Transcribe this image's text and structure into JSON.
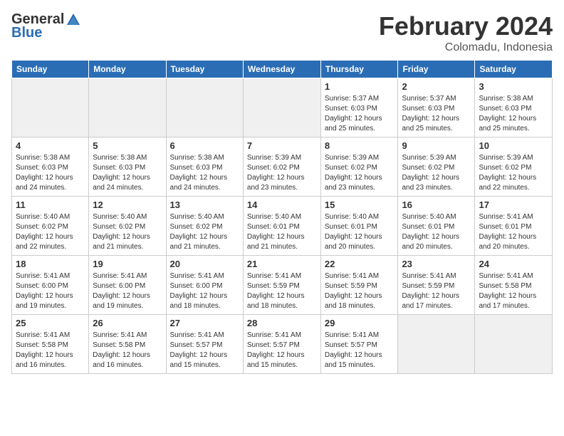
{
  "header": {
    "logo_general": "General",
    "logo_blue": "Blue",
    "month": "February 2024",
    "location": "Colomadu, Indonesia"
  },
  "weekdays": [
    "Sunday",
    "Monday",
    "Tuesday",
    "Wednesday",
    "Thursday",
    "Friday",
    "Saturday"
  ],
  "weeks": [
    [
      {
        "day": "",
        "info": "",
        "empty": true
      },
      {
        "day": "",
        "info": "",
        "empty": true
      },
      {
        "day": "",
        "info": "",
        "empty": true
      },
      {
        "day": "",
        "info": "",
        "empty": true
      },
      {
        "day": "1",
        "info": "Sunrise: 5:37 AM\nSunset: 6:03 PM\nDaylight: 12 hours\nand 25 minutes."
      },
      {
        "day": "2",
        "info": "Sunrise: 5:37 AM\nSunset: 6:03 PM\nDaylight: 12 hours\nand 25 minutes."
      },
      {
        "day": "3",
        "info": "Sunrise: 5:38 AM\nSunset: 6:03 PM\nDaylight: 12 hours\nand 25 minutes."
      }
    ],
    [
      {
        "day": "4",
        "info": "Sunrise: 5:38 AM\nSunset: 6:03 PM\nDaylight: 12 hours\nand 24 minutes."
      },
      {
        "day": "5",
        "info": "Sunrise: 5:38 AM\nSunset: 6:03 PM\nDaylight: 12 hours\nand 24 minutes."
      },
      {
        "day": "6",
        "info": "Sunrise: 5:38 AM\nSunset: 6:03 PM\nDaylight: 12 hours\nand 24 minutes."
      },
      {
        "day": "7",
        "info": "Sunrise: 5:39 AM\nSunset: 6:02 PM\nDaylight: 12 hours\nand 23 minutes."
      },
      {
        "day": "8",
        "info": "Sunrise: 5:39 AM\nSunset: 6:02 PM\nDaylight: 12 hours\nand 23 minutes."
      },
      {
        "day": "9",
        "info": "Sunrise: 5:39 AM\nSunset: 6:02 PM\nDaylight: 12 hours\nand 23 minutes."
      },
      {
        "day": "10",
        "info": "Sunrise: 5:39 AM\nSunset: 6:02 PM\nDaylight: 12 hours\nand 22 minutes."
      }
    ],
    [
      {
        "day": "11",
        "info": "Sunrise: 5:40 AM\nSunset: 6:02 PM\nDaylight: 12 hours\nand 22 minutes."
      },
      {
        "day": "12",
        "info": "Sunrise: 5:40 AM\nSunset: 6:02 PM\nDaylight: 12 hours\nand 21 minutes."
      },
      {
        "day": "13",
        "info": "Sunrise: 5:40 AM\nSunset: 6:02 PM\nDaylight: 12 hours\nand 21 minutes."
      },
      {
        "day": "14",
        "info": "Sunrise: 5:40 AM\nSunset: 6:01 PM\nDaylight: 12 hours\nand 21 minutes."
      },
      {
        "day": "15",
        "info": "Sunrise: 5:40 AM\nSunset: 6:01 PM\nDaylight: 12 hours\nand 20 minutes."
      },
      {
        "day": "16",
        "info": "Sunrise: 5:40 AM\nSunset: 6:01 PM\nDaylight: 12 hours\nand 20 minutes."
      },
      {
        "day": "17",
        "info": "Sunrise: 5:41 AM\nSunset: 6:01 PM\nDaylight: 12 hours\nand 20 minutes."
      }
    ],
    [
      {
        "day": "18",
        "info": "Sunrise: 5:41 AM\nSunset: 6:00 PM\nDaylight: 12 hours\nand 19 minutes."
      },
      {
        "day": "19",
        "info": "Sunrise: 5:41 AM\nSunset: 6:00 PM\nDaylight: 12 hours\nand 19 minutes."
      },
      {
        "day": "20",
        "info": "Sunrise: 5:41 AM\nSunset: 6:00 PM\nDaylight: 12 hours\nand 18 minutes."
      },
      {
        "day": "21",
        "info": "Sunrise: 5:41 AM\nSunset: 5:59 PM\nDaylight: 12 hours\nand 18 minutes."
      },
      {
        "day": "22",
        "info": "Sunrise: 5:41 AM\nSunset: 5:59 PM\nDaylight: 12 hours\nand 18 minutes."
      },
      {
        "day": "23",
        "info": "Sunrise: 5:41 AM\nSunset: 5:59 PM\nDaylight: 12 hours\nand 17 minutes."
      },
      {
        "day": "24",
        "info": "Sunrise: 5:41 AM\nSunset: 5:58 PM\nDaylight: 12 hours\nand 17 minutes."
      }
    ],
    [
      {
        "day": "25",
        "info": "Sunrise: 5:41 AM\nSunset: 5:58 PM\nDaylight: 12 hours\nand 16 minutes."
      },
      {
        "day": "26",
        "info": "Sunrise: 5:41 AM\nSunset: 5:58 PM\nDaylight: 12 hours\nand 16 minutes."
      },
      {
        "day": "27",
        "info": "Sunrise: 5:41 AM\nSunset: 5:57 PM\nDaylight: 12 hours\nand 15 minutes."
      },
      {
        "day": "28",
        "info": "Sunrise: 5:41 AM\nSunset: 5:57 PM\nDaylight: 12 hours\nand 15 minutes."
      },
      {
        "day": "29",
        "info": "Sunrise: 5:41 AM\nSunset: 5:57 PM\nDaylight: 12 hours\nand 15 minutes."
      },
      {
        "day": "",
        "info": "",
        "empty": true
      },
      {
        "day": "",
        "info": "",
        "empty": true
      }
    ]
  ]
}
